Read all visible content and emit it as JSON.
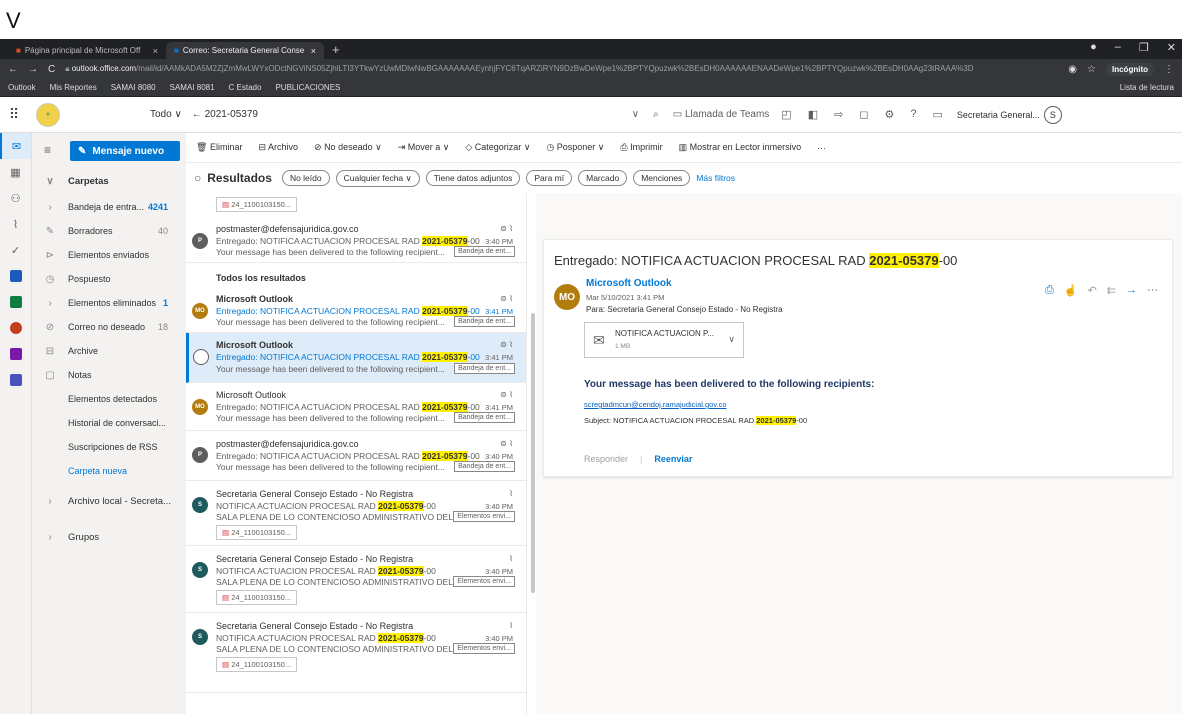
{
  "caption_letter": "V",
  "browser": {
    "tabs": [
      {
        "title": "Página principal de Microsoft Off",
        "close": "×"
      },
      {
        "title": "Correo: Secretaria General Conse",
        "close": "×"
      }
    ],
    "new_tab": "+",
    "url_host": "outlook.office.com",
    "url_path": "/mail/id/AAMkADA5M2ZjZmMwLWYxODctNGViNS05ZjhlLTI3YTkwYzUwMDlwNwBGAAAAAAAEynhjFYC6TqARZiRYN9DzBwDeWpe1%2BPTYQpuzwk%2BEsDH0AAAAAAENAADeWpe1%2BPTYQpuzwk%2BEsDH0AAg23tRAAA%3D",
    "incognito_label": "Incógnito",
    "bookmarks": [
      "Outlook",
      "Mis Reportes",
      "SAMAI 8080",
      "SAMAI 8081",
      "C Estado",
      "PUBLICACIONES"
    ],
    "reading_list": "Lista de lectura",
    "window_controls": [
      "●",
      "–",
      "❐",
      "✕"
    ]
  },
  "owa": {
    "scope": "Todo",
    "search_value": "2021-05379",
    "teams_label": "Llamada de Teams",
    "account": "Secretaria General...",
    "account_initial": "S"
  },
  "folders": {
    "new_mail": "Mensaje nuevo",
    "header": "Carpetas",
    "items": [
      {
        "label": "Bandeja de entra...",
        "count": "4241",
        "bold": true
      },
      {
        "label": "Borradores",
        "count": "40"
      },
      {
        "label": "Elementos enviados",
        "count": ""
      },
      {
        "label": "Pospuesto",
        "count": ""
      },
      {
        "label": "Elementos eliminados",
        "count": "1",
        "bold": true
      },
      {
        "label": "Correo no deseado",
        "count": "18"
      },
      {
        "label": "Archive",
        "count": ""
      },
      {
        "label": "Notas",
        "count": ""
      },
      {
        "label": "Elementos detectados",
        "count": ""
      },
      {
        "label": "Historial de conversaci...",
        "count": ""
      },
      {
        "label": "Suscripciones de RSS",
        "count": ""
      },
      {
        "label": "Carpeta nueva",
        "count": ""
      }
    ],
    "local_archive": "Archivo local - Secreta...",
    "groups": "Grupos"
  },
  "commands": [
    "Eliminar",
    "Archivo",
    "No deseado",
    "Mover a",
    "Categorizar",
    "Posponer",
    "Imprimir",
    "Mostrar en Lector inmersivo",
    "···"
  ],
  "filters": {
    "title": "Resultados",
    "pills": [
      "No leído",
      "Cualquier fecha ∨",
      "Tiene datos adjuntos",
      "Para mí",
      "Marcado",
      "Menciones"
    ],
    "more": "Más filtros"
  },
  "list": {
    "section_all": "Todos los resultados",
    "top_attachment": "24_1100103150...",
    "messages": [
      {
        "sender": "postmaster@defensajuridica.gov.co",
        "subj_pre": "Entregado: NOTIFICA ACTUACION PROCESAL RAD ",
        "subj_post": "-00",
        "time": "3:40 PM",
        "preview": "Your message has been delivered to the following recipient...",
        "folder": "Bandeja de ent...",
        "initial": "P"
      },
      {
        "sender": "Microsoft Outlook",
        "subj_pre": "Entregado: NOTIFICA ACTUACION PROCESAL RAD ",
        "subj_post": "-00",
        "time": "3:41 PM",
        "preview": "Your message has been delivered to the following recipient...",
        "folder": "Bandeja de ent...",
        "initial": "MO"
      },
      {
        "sender": "Microsoft Outlook",
        "subj_pre": "Entregado: NOTIFICA ACTUACION PROCESAL RAD ",
        "subj_post": "-00",
        "time": "3:41 PM",
        "preview": "Your message has been delivered to the following recipient...",
        "folder": "Bandeja de ent...",
        "initial": ""
      },
      {
        "sender": "Microsoft Outlook",
        "subj_pre": "Entregado: NOTIFICA ACTUACION PROCESAL RAD ",
        "subj_post": "-00",
        "time": "3:41 PM",
        "preview": "Your message has been delivered to the following recipient...",
        "folder": "Bandeja de ent...",
        "initial": "MO"
      },
      {
        "sender": "postmaster@defensajuridica.gov.co",
        "subj_pre": "Entregado: NOTIFICA ACTUACION PROCESAL RAD ",
        "subj_post": "-00",
        "time": "3:40 PM",
        "preview": "Your message has been delivered to the following recipient...",
        "folder": "Bandeja de ent...",
        "initial": "P"
      },
      {
        "sender": "Secretaria General Consejo Estado - No Registra",
        "subj_pre": "NOTIFICA ACTUACION PROCESAL RAD ",
        "subj_post": "-00",
        "time": "3:40 PM",
        "preview": "SALA PLENA DE LO CONTENCIOSO ADMINISTRATIVO DEL ...",
        "folder": "Elementos envi...",
        "initial": "S",
        "attachment": "24_1100103150..."
      },
      {
        "sender": "Secretaria General Consejo Estado - No Registra",
        "subj_pre": "NOTIFICA ACTUACION PROCESAL RAD ",
        "subj_post": "-00",
        "time": "3:40 PM",
        "preview": "SALA PLENA DE LO CONTENCIOSO ADMINISTRATIVO DEL ...",
        "folder": "Elementos envi...",
        "initial": "S",
        "attachment": "24_1100103150..."
      },
      {
        "sender": "Secretaria General Consejo Estado - No Registra",
        "subj_pre": "NOTIFICA ACTUACION PROCESAL RAD ",
        "subj_post": "-00",
        "time": "3:40 PM",
        "preview": "SALA PLENA DE LO CONTENCIOSO ADMINISTRATIVO DEL ...",
        "folder": "Elementos envi...",
        "initial": "S",
        "attachment": "24_1100103150..."
      }
    ],
    "highlight": "2021-05379"
  },
  "reading": {
    "title_pre": "Entregado: NOTIFICA ACTUACION PROCESAL RAD ",
    "title_hl": "2021-05379",
    "title_post": "-00",
    "sender": "Microsoft Outlook",
    "initials": "MO",
    "date": "Mar 5/10/2021 3:41 PM",
    "to": "Para: Secretaria General Consejo Estado - No Registra",
    "attachment_name": "NOTIFICA ACTUACION P...",
    "attachment_size": "1 MB",
    "body_heading": "Your message has been delivered to the following recipients:",
    "recipient": "scregtadmcun@cendoj.ramajudicial.gov.co",
    "subject_pre": "Subject: NOTIFICA ACTUACION PROCESAL RAD ",
    "subject_hl": "2021-05379",
    "subject_post": "-00",
    "reply": "Responder",
    "forward": "Reenviar"
  },
  "colors": {
    "accent": "#0078d4",
    "highlight": "#fff100"
  }
}
